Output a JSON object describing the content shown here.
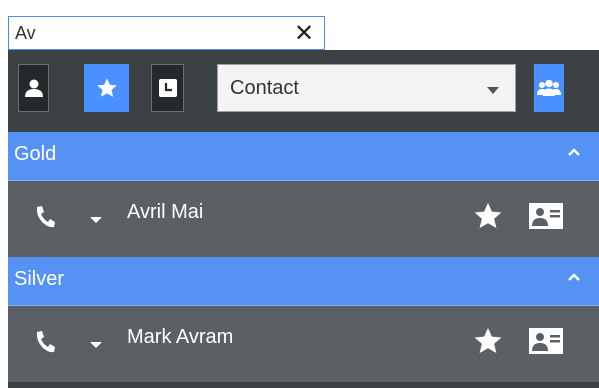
{
  "search": {
    "value": "Av",
    "clear_glyph": "✕"
  },
  "toolbar": {
    "buttons": [
      {
        "icon": "contact-icon",
        "active": false
      },
      {
        "icon": "star-icon",
        "active": true
      },
      {
        "icon": "recent-icon",
        "active": false
      }
    ],
    "filter_select": {
      "value": "Contact"
    },
    "group_button_icon": "group-icon"
  },
  "sections": [
    {
      "title": "Gold",
      "contacts": [
        {
          "name": "Avril Mai"
        }
      ]
    },
    {
      "title": "Silver",
      "contacts": [
        {
          "name": "Mark Avram"
        }
      ]
    }
  ],
  "colors": {
    "accent": "#4a90ff",
    "section_header": "#5592f4",
    "panel_bg": "#3c4144",
    "row_bg": "#5a6064"
  }
}
